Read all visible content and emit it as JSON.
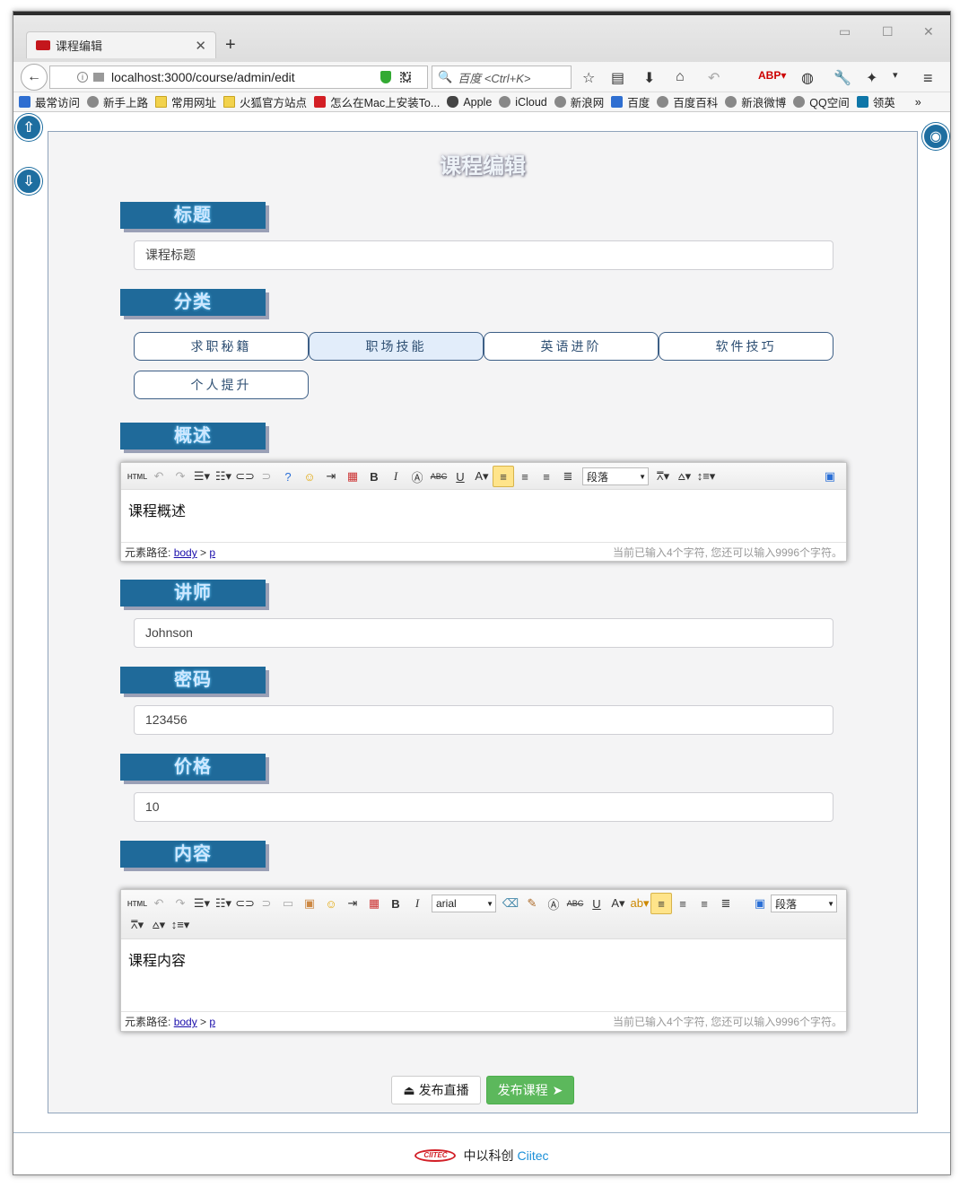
{
  "browser": {
    "tab_title": "课程编辑",
    "url": "localhost:3000/course/admin/edit",
    "search_placeholder": "百度 <Ctrl+K>",
    "bookmarks": [
      "最常访问",
      "新手上路",
      "常用网址",
      "火狐官方站点",
      "怎么在Mac上安装To...",
      "Apple",
      "iCloud",
      "新浪网",
      "百度",
      "百度百科",
      "新浪微博",
      "QQ空间",
      "领英"
    ]
  },
  "page": {
    "title": "课程编辑",
    "sections": {
      "title_label": "标题",
      "category_label": "分类",
      "summary_label": "概述",
      "teacher_label": "讲师",
      "password_label": "密码",
      "price_label": "价格",
      "content_label": "内容"
    },
    "fields": {
      "title_value": "课程标题",
      "teacher_value": "Johnson",
      "password_value": "123456",
      "price_value": "10"
    },
    "categories": [
      "求职秘籍",
      "职场技能",
      "英语进阶",
      "软件技巧",
      "个人提升"
    ],
    "selected_category": "职场技能",
    "summary_editor": {
      "paragraph_select": "段落",
      "body": "课程概述",
      "path_label": "元素路径:",
      "path_body": "body",
      "path_p": "p",
      "counter": "当前已输入4个字符, 您还可以输入9996个字符。"
    },
    "content_editor": {
      "font_select": "arial",
      "paragraph_select": "段落",
      "body": "课程内容",
      "path_label": "元素路径:",
      "path_body": "body",
      "path_p": "p",
      "counter": "当前已输入4个字符, 您还可以输入9996个字符。"
    },
    "buttons": {
      "live": "发布直播",
      "publish": "发布课程"
    }
  },
  "footer": {
    "logo_text": "CIITEC",
    "company_cn": "中以科创",
    "company_en": "Ciitec"
  },
  "colors": {
    "section_bg": "#1f6a9a",
    "publish_green": "#5cb85c",
    "link_blue": "#1a0dab"
  }
}
